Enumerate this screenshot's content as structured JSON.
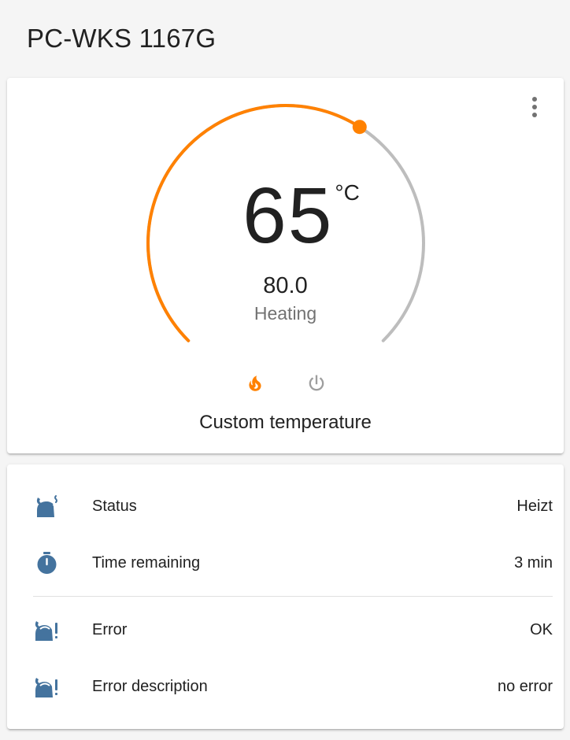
{
  "page": {
    "title": "PC-WKS 1167G"
  },
  "thermostat": {
    "current_temperature": "65",
    "unit": "°C",
    "target_temperature": "80.0",
    "hvac_action": "Heating",
    "preset": "Custom temperature",
    "setpoint_fraction": 0.62,
    "colors": {
      "heat": "#ff8100",
      "track": "#bdbdbd",
      "off": "#9e9e9e"
    },
    "modes": [
      {
        "name": "heat",
        "icon": "fire-icon",
        "active": true
      },
      {
        "name": "off",
        "icon": "power-icon",
        "active": false
      }
    ]
  },
  "entities": {
    "icon_color": "#44739e",
    "rows": [
      {
        "label": "Status",
        "value": "Heizt",
        "icon": "kettle-steam-icon"
      },
      {
        "label": "Time remaining",
        "value": "3 min",
        "icon": "timer-icon"
      },
      {
        "label": "Error",
        "value": "OK",
        "icon": "kettle-alert-icon"
      },
      {
        "label": "Error description",
        "value": "no error",
        "icon": "kettle-alert-icon"
      }
    ]
  }
}
